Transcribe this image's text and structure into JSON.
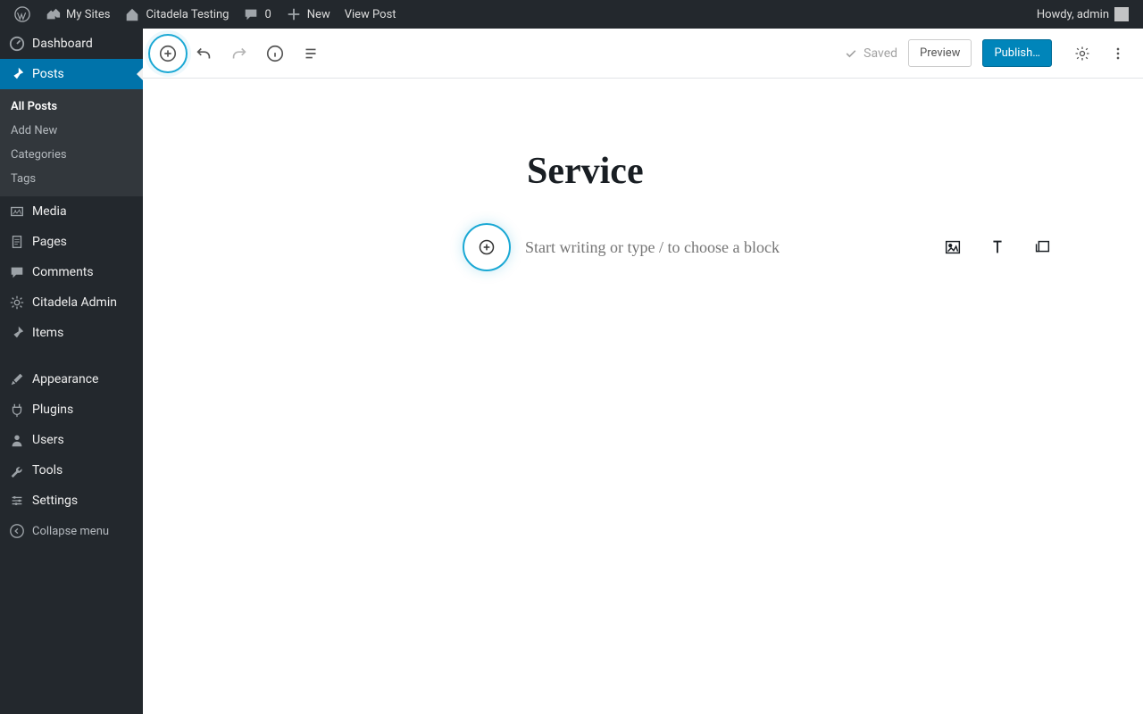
{
  "adminbar": {
    "my_sites": "My Sites",
    "site_name": "Citadela Testing",
    "comments_count": "0",
    "new": "New",
    "view_post": "View Post",
    "howdy": "Howdy, admin"
  },
  "sidebar": {
    "dashboard": "Dashboard",
    "posts": "Posts",
    "posts_sub": {
      "all": "All Posts",
      "add": "Add New",
      "cats": "Categories",
      "tags": "Tags"
    },
    "media": "Media",
    "pages": "Pages",
    "comments": "Comments",
    "citadela": "Citadela Admin",
    "items": "Items",
    "appearance": "Appearance",
    "plugins": "Plugins",
    "users": "Users",
    "tools": "Tools",
    "settings": "Settings",
    "collapse": "Collapse menu"
  },
  "editor": {
    "saved": "Saved",
    "preview": "Preview",
    "publish": "Publish…",
    "post_title": "Service",
    "placeholder": "Start writing or type / to choose a block"
  }
}
